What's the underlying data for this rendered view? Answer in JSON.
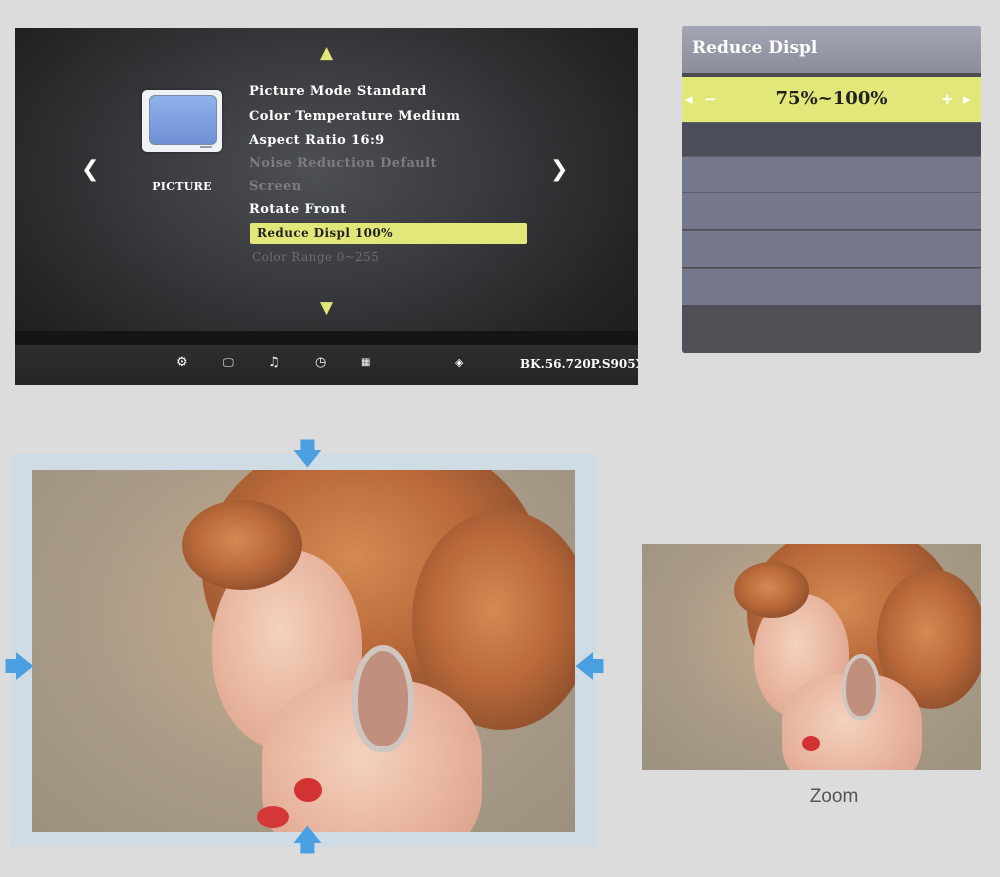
{
  "osd": {
    "category": "PICTURE",
    "items": [
      {
        "label": "Picture Mode Standard",
        "state": "enabled"
      },
      {
        "label": "Color Temperature Medium",
        "state": "enabled"
      },
      {
        "label": "Aspect Ratio 16:9",
        "state": "enabled"
      },
      {
        "label": "Noise Reduction Default",
        "state": "disabled"
      },
      {
        "label": "Screen",
        "state": "disabled"
      },
      {
        "label": "Rotate Front",
        "state": "enabled"
      },
      {
        "label": "Reduce Displ 100%",
        "state": "selected"
      },
      {
        "label": "Color Range 0~255",
        "state": "disabled"
      }
    ],
    "footer_icons": [
      "gear-icon",
      "monitor-icon",
      "music-icon",
      "clock-icon",
      "apps-icon",
      "3d-cube-icon"
    ],
    "model": "BK.56.720P.S905X",
    "accent": "#e2e77a"
  },
  "popup": {
    "title": "Reduce Displ",
    "value": "75%~100%"
  },
  "zoom_caption": "Zoom",
  "arrow_color": "#4a9fe0"
}
